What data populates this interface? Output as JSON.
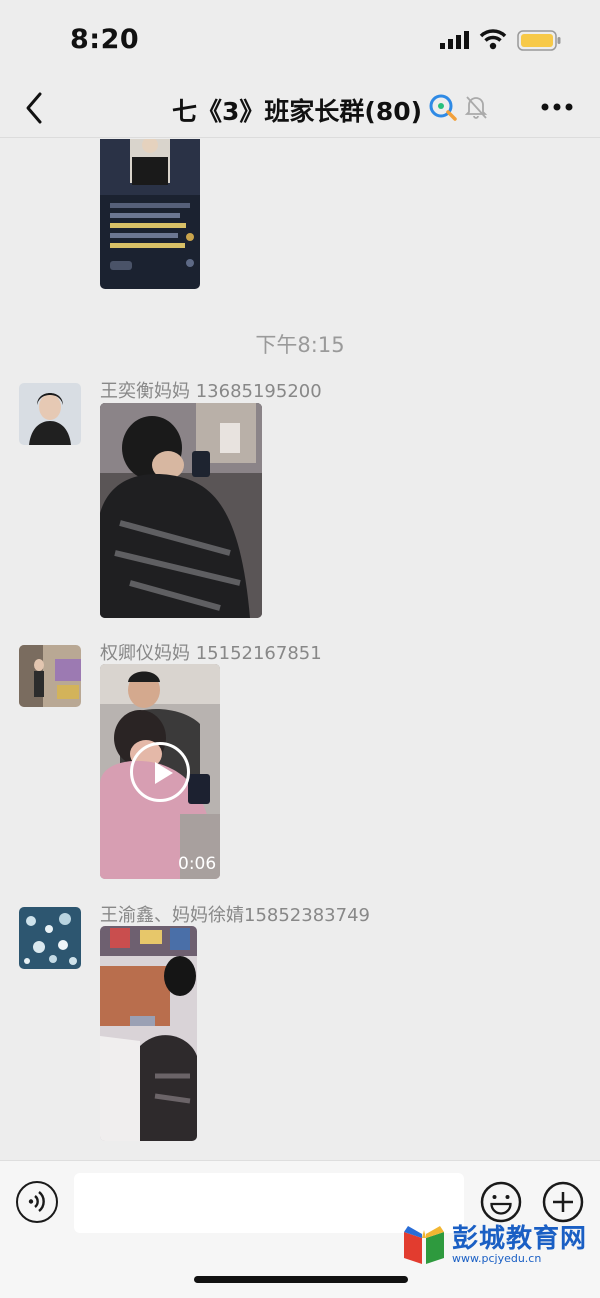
{
  "status_bar": {
    "time": "8:20"
  },
  "nav": {
    "title": "七《3》班家长群(80)"
  },
  "messages": {
    "timestamp": "下午8:15",
    "items": [
      {
        "sender": "王奕衡妈妈 13685195200",
        "type": "image"
      },
      {
        "sender": "权卿仪妈妈 15152167851",
        "type": "video",
        "duration": "0:06"
      },
      {
        "sender": "王渝鑫、妈妈徐婧15852383749",
        "type": "image"
      }
    ]
  },
  "input": {
    "value": "",
    "placeholder": ""
  },
  "watermark": {
    "title": "彭城教育网",
    "url": "www.pcjyedu.cn"
  },
  "colors": {
    "background": "#ededed",
    "input_bar": "#f6f6f6",
    "battery": "#f7c948",
    "watermark": "#1a5fc4"
  },
  "icons": [
    "back-icon",
    "qq-icon",
    "mute-icon",
    "more-icon",
    "voice-icon",
    "emoji-icon",
    "add-icon",
    "play-icon"
  ]
}
